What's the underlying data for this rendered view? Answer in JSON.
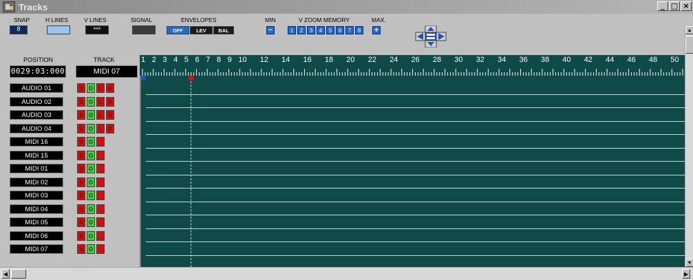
{
  "window": {
    "title": "Tracks",
    "min_label": "_",
    "max_label": "□",
    "close_label": "×"
  },
  "toolbar": {
    "snap_label": "SNAP",
    "snap_value": "8",
    "hlines_label": "H LINES",
    "vlines_label": "V LINES",
    "vlines_value": "***",
    "signal_label": "SIGNAL",
    "envelopes_label": "ENVELOPES",
    "env_off": "OFF",
    "env_lev": "LEV",
    "env_bal": "BAL",
    "min_label": "MIN",
    "min_btn": "−",
    "vzoom_label": "V ZOOM MEMORY",
    "zoom_slots": [
      "1",
      "2",
      "3",
      "4",
      "5",
      "6",
      "7",
      "8"
    ],
    "max_label": "MAX.",
    "max_btn": "+"
  },
  "header": {
    "position_label": "POSITION",
    "position_value": "0029:03:000",
    "track_label": "TRACK",
    "track_value": "MIDI 07"
  },
  "ruler": {
    "labels": [
      "1",
      "2",
      "3",
      "4",
      "5",
      "6",
      "7",
      "8",
      "9",
      "10",
      "12",
      "14",
      "16",
      "18",
      "20",
      "22",
      "24",
      "26",
      "28",
      "30",
      "32",
      "34",
      "36",
      "38",
      "40",
      "42",
      "44",
      "46",
      "48",
      "50"
    ]
  },
  "tracks": [
    {
      "name": "AUDIO 01",
      "s": "S",
      "o": "O",
      "l": "L",
      "r": "R"
    },
    {
      "name": "AUDIO 02",
      "s": "S",
      "o": "O",
      "l": "L",
      "r": "R"
    },
    {
      "name": "AUDIO 03",
      "s": "S",
      "o": "O",
      "l": "L",
      "r": "R"
    },
    {
      "name": "AUDIO 04",
      "s": "S",
      "o": "O",
      "l": "L",
      "r": "R"
    },
    {
      "name": "MIDI 16",
      "s": "S",
      "o": "O",
      "l": "",
      "r": ""
    },
    {
      "name": "MIDI 15",
      "s": "S",
      "o": "O",
      "l": "",
      "r": ""
    },
    {
      "name": "MIDI 01",
      "s": "S",
      "o": "O",
      "l": "",
      "r": ""
    },
    {
      "name": "MIDI 02",
      "s": "S",
      "o": "O",
      "l": "",
      "r": ""
    },
    {
      "name": "MIDI 03",
      "s": "S",
      "o": "O",
      "l": "",
      "r": ""
    },
    {
      "name": "MIDI 04",
      "s": "S",
      "o": "O",
      "l": "",
      "r": ""
    },
    {
      "name": "MIDI 05",
      "s": "S",
      "o": "O",
      "l": "",
      "r": ""
    },
    {
      "name": "MIDI 06",
      "s": "S",
      "o": "O",
      "l": "",
      "r": ""
    },
    {
      "name": "MIDI 07",
      "s": "S",
      "o": "O",
      "l": "",
      "r": ""
    }
  ],
  "colors": {
    "lane_bg": "#0f4a48",
    "solo": "#d01010",
    "on": "#3cd03c",
    "accent": "#1e6ad6"
  }
}
